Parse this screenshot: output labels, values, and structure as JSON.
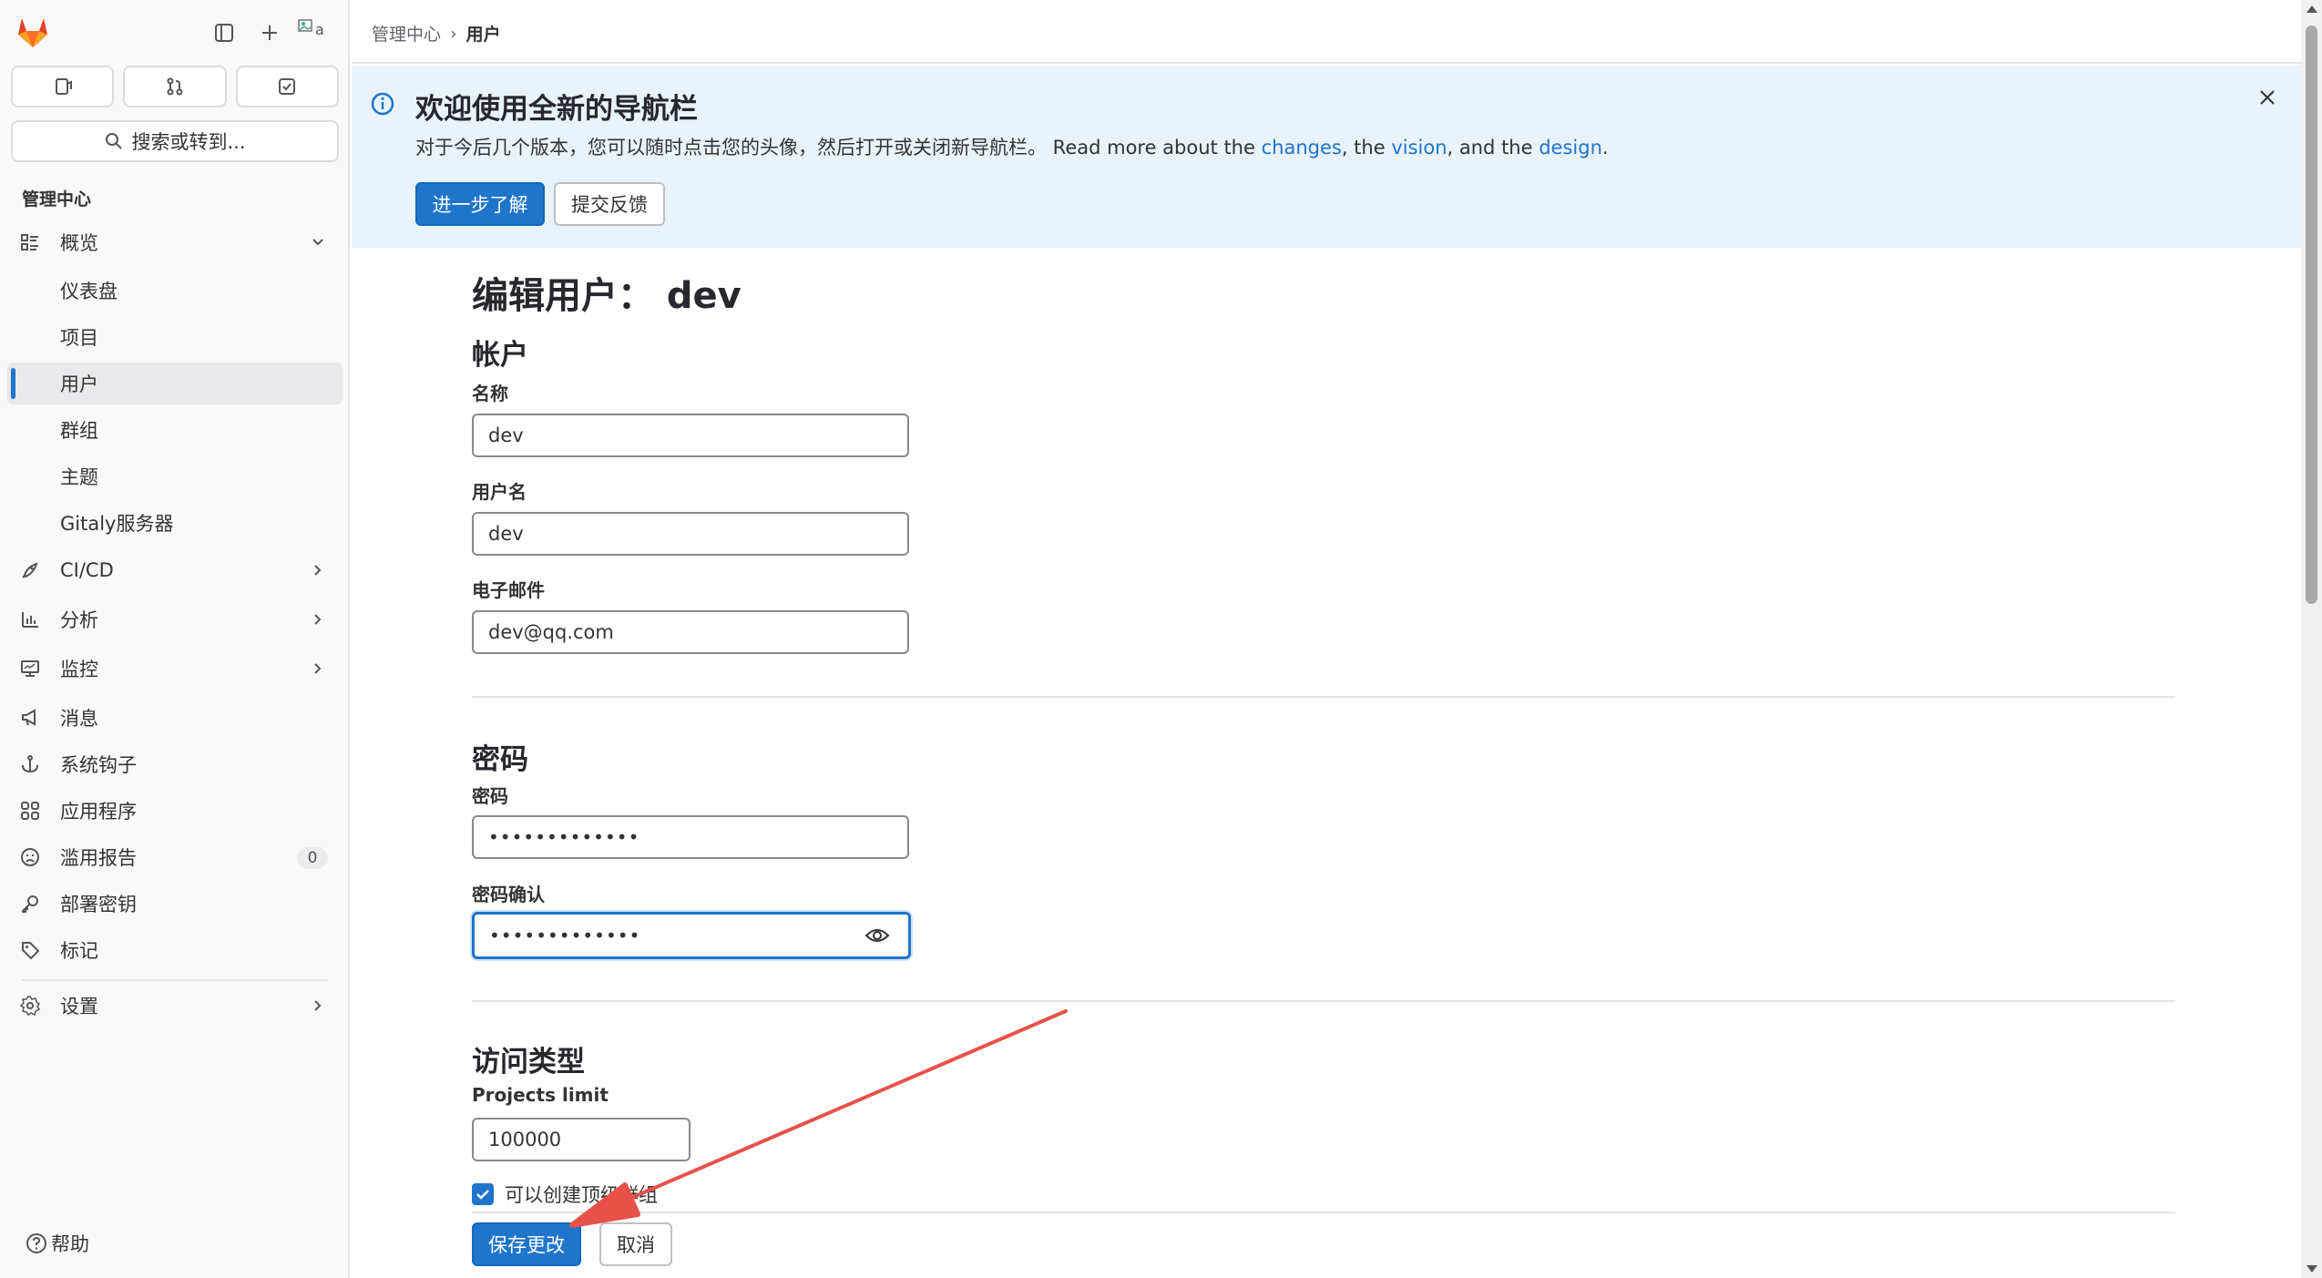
{
  "sidebar": {
    "avatar_alt": "a",
    "search_label": "搜索或转到...",
    "section_label": "管理中心",
    "items": [
      {
        "label": "概览"
      },
      {
        "label": "仪表盘"
      },
      {
        "label": "项目"
      },
      {
        "label": "用户"
      },
      {
        "label": "群组"
      },
      {
        "label": "主题"
      },
      {
        "label": "Gitaly服务器"
      },
      {
        "label": "CI/CD"
      },
      {
        "label": "分析"
      },
      {
        "label": "监控"
      },
      {
        "label": "消息"
      },
      {
        "label": "系统钩子"
      },
      {
        "label": "应用程序"
      },
      {
        "label": "滥用报告",
        "badge": "0"
      },
      {
        "label": "部署密钥"
      },
      {
        "label": "标记"
      },
      {
        "label": "设置"
      }
    ],
    "help_label": "帮助"
  },
  "breadcrumb": {
    "parent": "管理中心",
    "separator": "›",
    "current": "用户"
  },
  "banner": {
    "title": "欢迎使用全新的导航栏",
    "text_prefix": "对于今后几个版本，您可以随时点击您的头像，然后打开或关闭新导航栏。 Read more about the ",
    "link_changes": "changes",
    "text_mid1": ", the ",
    "link_vision": "vision",
    "text_mid2": ", and the ",
    "link_design": "design",
    "text_end": ".",
    "learn_more": "进一步了解",
    "feedback": "提交反馈"
  },
  "form": {
    "page_title": "编辑用户： dev",
    "account_section": "帐户",
    "name_label": "名称",
    "name_value": "dev",
    "username_label": "用户名",
    "username_value": "dev",
    "email_label": "电子邮件",
    "email_value": "dev@qq.com",
    "password_section": "密码",
    "password_label": "密码",
    "password_value": "•••••••••••••",
    "password_confirm_label": "密码确认",
    "password_confirm_value": "•••••••••••••",
    "access_section": "访问类型",
    "projects_limit_label": "Projects limit",
    "projects_limit_value": "100000",
    "can_create_group_label": "可以创建顶级群组",
    "can_create_group_checked": true,
    "save_label": "保存更改",
    "cancel_label": "取消"
  },
  "colors": {
    "accent": "#1f75cb",
    "banner_bg": "#e9f3fc",
    "annotation_arrow": "#e8504a"
  }
}
